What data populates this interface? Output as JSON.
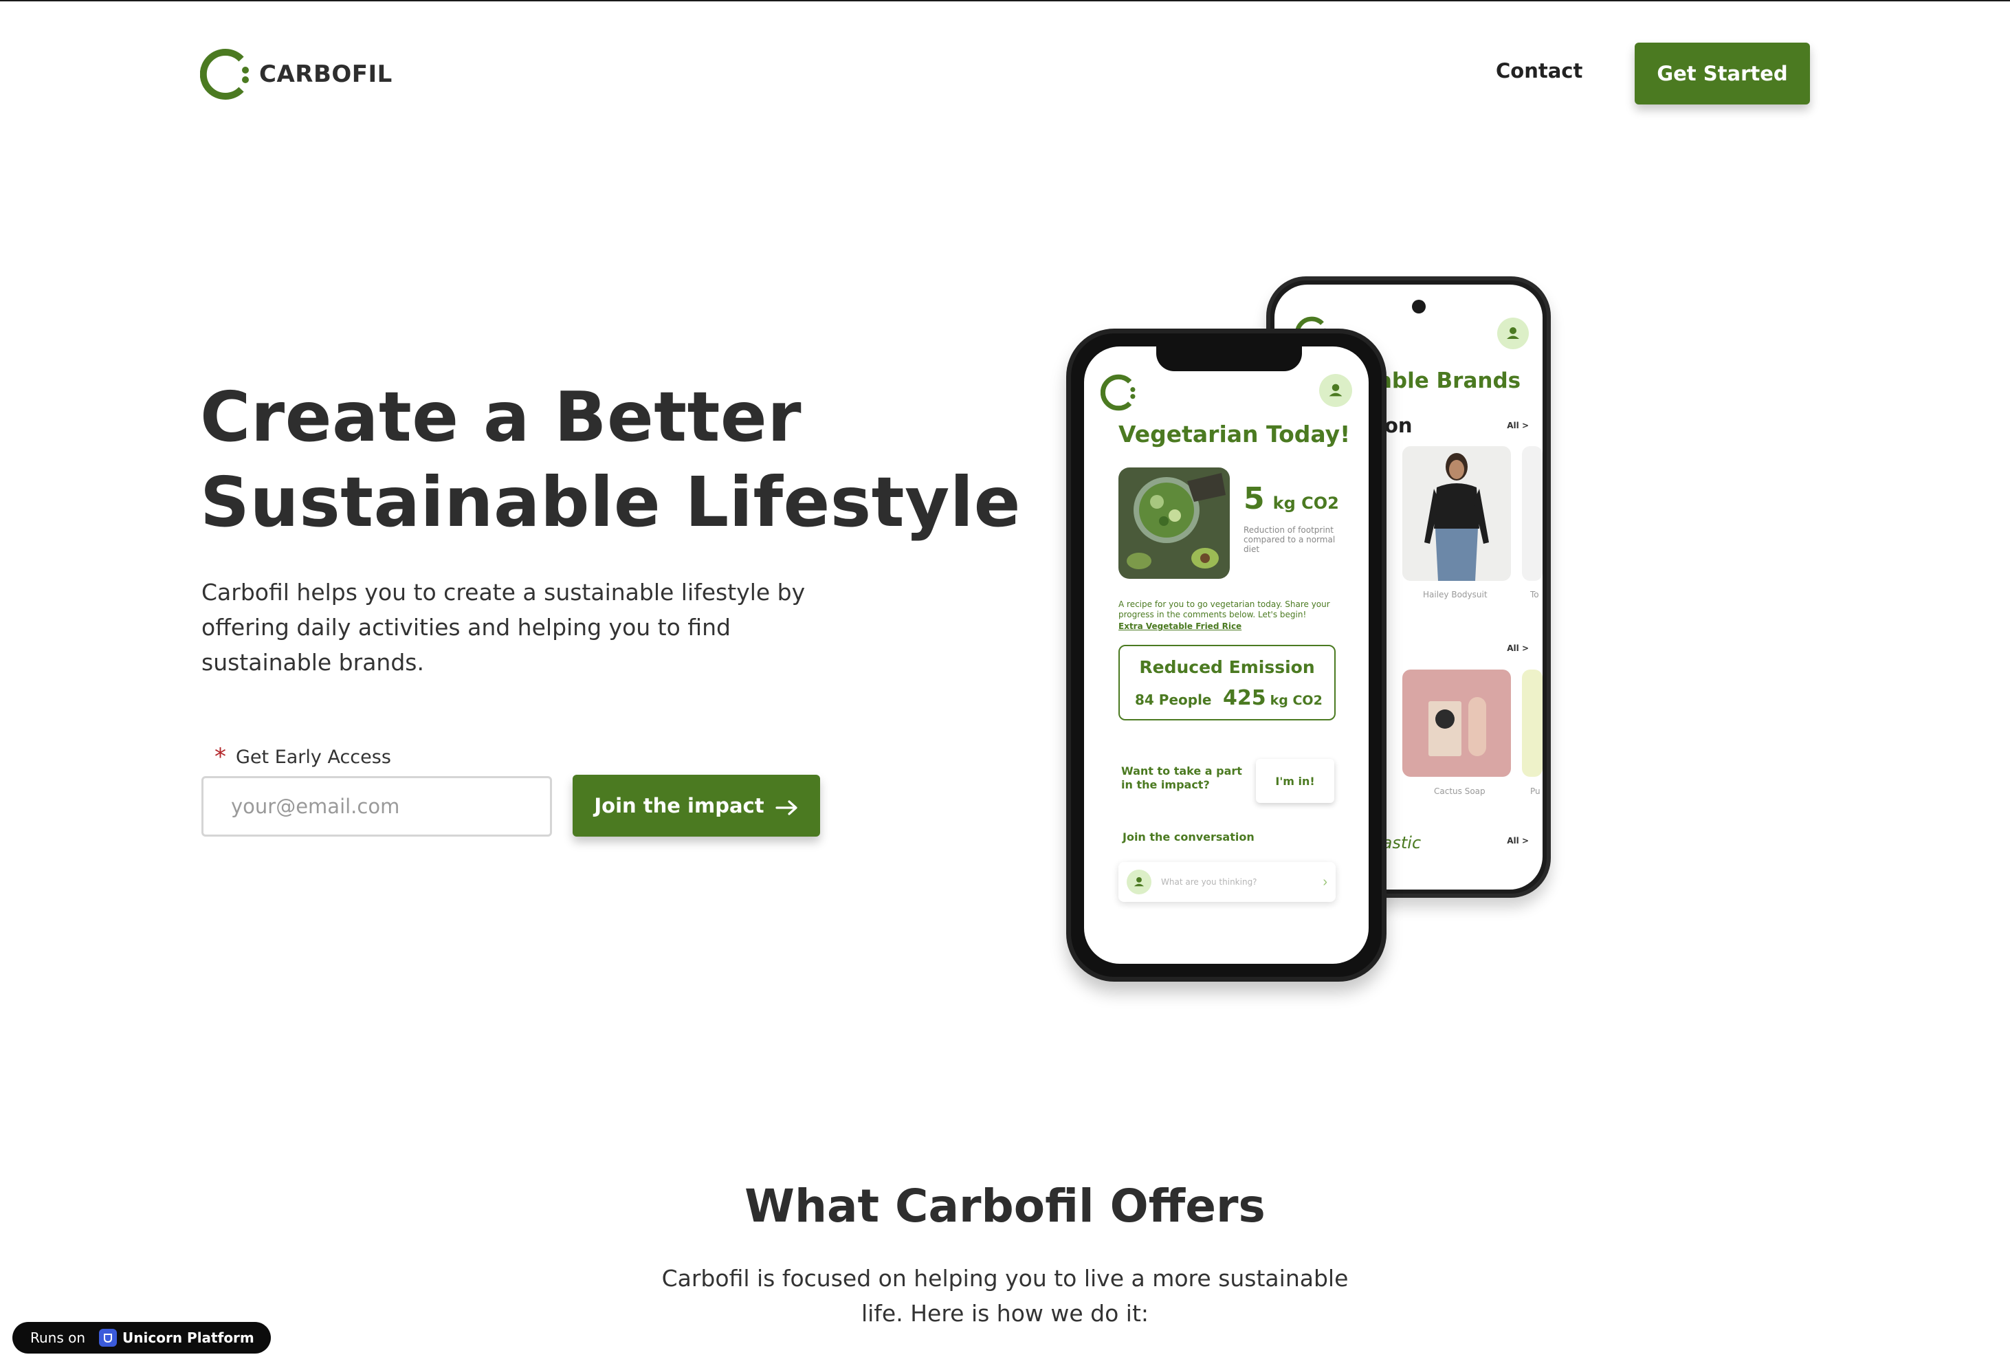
{
  "header": {
    "brand": "CARBOFIL",
    "nav_contact": "Contact",
    "cta": "Get Started"
  },
  "hero": {
    "title_line1": "Create a Better",
    "title_line2": "Sustainable Lifestyle",
    "description": "Carbofil helps you to create a sustainable lifestyle by offering daily activities and helping you to find sustainable brands.",
    "form_label": "Get Early Access",
    "required_mark": "*",
    "email_placeholder": "your@email.com",
    "join_button": "Join the impact"
  },
  "phone_front": {
    "title": "Vegetarian Today!",
    "co2_value": "5",
    "co2_unit": "kg CO2",
    "co2_note": "Reduction of footprint compared to a normal diet",
    "recipe_text": "A recipe for you to go vegetarian today. Share your progress in the comments below. Let's begin!",
    "recipe_link": "Extra Vegetable Fried Rice",
    "emission_title": "Reduced Emission",
    "emission_people": "84 People",
    "emission_value": "425",
    "emission_unit": "kg CO2",
    "impact_question": "Want to take a part in the impact?",
    "impact_button": "I'm in!",
    "conversation_title": "Join the conversation",
    "conversation_placeholder": "What are you thinking?"
  },
  "phone_back": {
    "title_fragment": "able Brands",
    "section_fragment": "ion",
    "all_link": "All >",
    "caption_1": "Hailey Bodysuit",
    "caption_1b": "To",
    "caption_2": "Cactus Soap",
    "caption_2b": "Pu",
    "section_plastic": "lastic"
  },
  "offers": {
    "title": "What Carbofil Offers",
    "description": "Carbofil is focused on helping you to live a more sustainable life. Here is how we do it:"
  },
  "badge": {
    "runs_on": "Runs on",
    "platform": "Unicorn Platform"
  },
  "colors": {
    "brand_green": "#4b7a21",
    "light_green": "#dcefc7",
    "text_dark": "#2e2e2e"
  }
}
